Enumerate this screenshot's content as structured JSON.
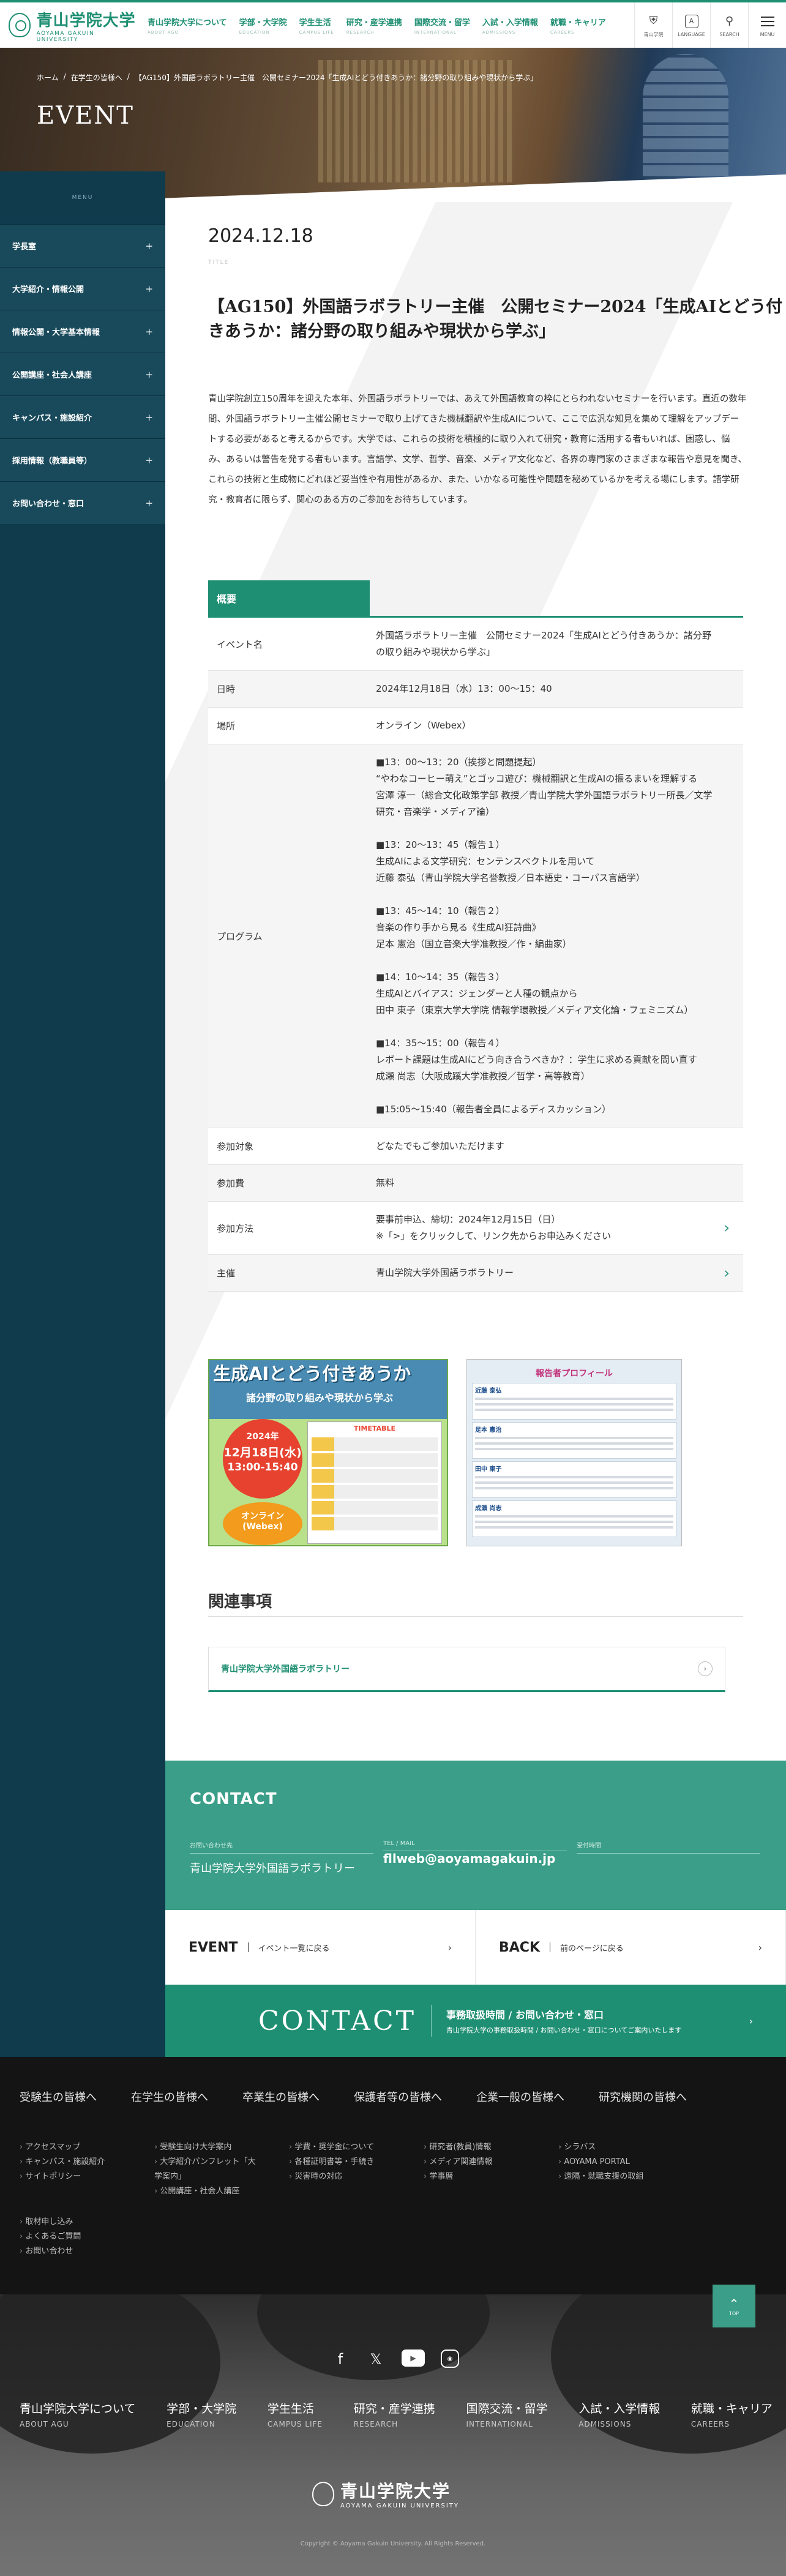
{
  "header": {
    "logo_jp": "青山学院大学",
    "logo_en": "AOYAMA GAKUIN UNIVERSITY",
    "nav": [
      {
        "label": "青山学院大学について",
        "sub": "ABOUT AGU"
      },
      {
        "label": "学部・大学院",
        "sub": "EDUCATION"
      },
      {
        "label": "学生生活",
        "sub": "CAMPUS LIFE"
      },
      {
        "label": "研究・産学連携",
        "sub": "RESEARCH"
      },
      {
        "label": "国際交流・留学",
        "sub": "INTERNATIONAL"
      },
      {
        "label": "入試・入学情報",
        "sub": "ADMISSIONS"
      },
      {
        "label": "就職・キャリア",
        "sub": "CAREERS"
      }
    ],
    "icons": [
      {
        "label": "青山学院",
        "icon": "school-emblem-icon"
      },
      {
        "label": "LANGUAGE",
        "icon": "language-icon"
      },
      {
        "label": "SEARCH",
        "icon": "search-icon"
      },
      {
        "label": "MENU",
        "icon": "menu-icon"
      }
    ]
  },
  "hero": {
    "breadcrumb": [
      "ホーム",
      "在学生の皆様へ",
      "【AG150】外国語ラボラトリー主催　公開セミナー2024「生成AIとどう付きあうか：諸分野の取り組みや現状から学ぶ」"
    ],
    "title": "EVENT"
  },
  "sidebar": {
    "heading": "MENU",
    "items": [
      "学長室",
      "大学紹介・情報公開",
      "情報公開・大学基本情報",
      "公開講座・社会人講座",
      "キャンパス・施設紹介",
      "採用情報（教職員等）",
      "お問い合わせ・窓口"
    ]
  },
  "article": {
    "date": "2024.12.18",
    "title_label": "TITLE",
    "title": "【AG150】外国語ラボラトリー主催　公開セミナー2024「生成AIとどう付きあうか：諸分野の取り組みや現状から学ぶ」",
    "lead": "青山学院創立150周年を迎えた本年、外国語ラボラトリーでは、あえて外国語教育の枠にとらわれないセミナーを行います。直近の数年間、外国語ラボラトリー主催公開セミナーで取り上げてきた機械翻訳や生成AIについて、ここで広汎な知見を集めて理解をアップデートする必要があると考えるからです。大学では、これらの技術を積極的に取り入れて研究・教育に活用する者もいれば、困惑し、悩み、あるいは警告を発する者もいます。言語学、文学、哲学、音楽、メディア文化など、各界の専門家のさまざまな報告や意見を聞き、これらの技術と生成物にどれほど妥当性や有用性があるか、また、いかなる可能性や問題を秘めているかを考える場にします。語学研究・教育者に限らず、関心のある方のご参加をお待ちしています。",
    "overview_tab": "概要",
    "rows": [
      {
        "th": "イベント名",
        "td": "外国語ラボラトリー主催　公開セミナー2024「生成AIとどう付きあうか：諸分野の取り組みや現状から学ぶ」"
      },
      {
        "th": "日時",
        "td": "2024年12月18日（水）13：00～15：40"
      },
      {
        "th": "場所",
        "td": "オンライン（Webex）"
      }
    ],
    "program_label": "プログラム",
    "program": [
      "■13：00～13：20（挨拶と問題提起）",
      "“やわなコーヒー萌え”とゴッコ遊び：機械翻訳と生成AIの振るまいを理解する",
      "宮澤 淳一（総合文化政策学部 教授／青山学院大学外国語ラボラトリー所長／文学研究・音楽学・メディア論）",
      "",
      "■13：20～13：45（報告１）",
      "生成AIによる文学研究：センテンスベクトルを用いて",
      "近藤 泰弘（青山学院大学名誉教授／日本語史・コーパス言語学）",
      "",
      "■13：45～14：10（報告２）",
      "音楽の作り手から見る《生成AI狂詩曲》",
      "足本 憲治（国立音楽大学准教授／作・編曲家）",
      "",
      "■14：10～14：35（報告３）",
      "生成AIとバイアス：ジェンダーと人種の観点から",
      "田中 東子（東京大学大学院 情報学環教授／メディア文化論・フェミニズム）",
      "",
      "■14：35～15：00（報告４）",
      "レポート課題は生成AIにどう向き合うべきか？：学生に求める貢献を問い直す",
      "成瀬 尚志（大阪成蹊大学准教授／哲学・高等教育）",
      "",
      "■15:05～15:40（報告者全員によるディスカッション）"
    ],
    "rows2": [
      {
        "th": "参加対象",
        "td": "どなたでもご参加いただけます"
      },
      {
        "th": "参加費",
        "td": "無料"
      }
    ],
    "apply_label": "参加方法",
    "apply_line1": "要事前申込、締切：2024年12月15日（日）",
    "apply_line2": "※「>」をクリックして、リンク先からお申込みください",
    "host_label": "主催",
    "host": "青山学院大学外国語ラボラトリー",
    "flyer1": {
      "title": "生成AIとどう付きあうか",
      "subtitle": "諸分野の取り組みや現状から学ぶ",
      "year": "2024年",
      "date": "12月18日(水)",
      "time": "13:00-15:40",
      "online": "オンライン(Webex)",
      "timetable": "TIMETABLE"
    },
    "flyer2": {
      "header": "報告者プロフィール",
      "speakers": [
        "近藤 泰弘",
        "足本 憲治",
        "田中 東子",
        "成瀬 尚志"
      ]
    },
    "related_heading": "関連事項",
    "related_link": "青山学院大学外国語ラボラトリー"
  },
  "contact": {
    "heading": "CONTACT",
    "cols": [
      {
        "label": "お問い合わせ先",
        "value": "青山学院大学外国語ラボラトリー"
      },
      {
        "label": "TEL / MAIL",
        "value": "fllweb@aoyamagakuin.jp"
      },
      {
        "label": "受付時間",
        "value": ""
      }
    ]
  },
  "eventback": [
    {
      "big": "EVENT",
      "small": "イベント一覧に戻る"
    },
    {
      "big": "BACK",
      "small": "前のページに戻る"
    }
  ],
  "contact2": {
    "big": "CONTACT",
    "t1": "事務取扱時間 / お問い合わせ・窓口",
    "t2": "青山学院大学の事務取扱時間 / お問い合わせ・窓口についてご案内いたします"
  },
  "footer": {
    "tabs": [
      "受験生の皆様へ",
      "在学生の皆様へ",
      "卒業生の皆様へ",
      "保護者等の皆様へ",
      "企業一般の皆様へ",
      "研究機関の皆様へ"
    ],
    "cols": [
      [
        "アクセスマップ",
        "キャンパス・施設紹介",
        "サイトポリシー"
      ],
      [
        "受験生向け大学案内",
        "大学紹介パンフレット「大学案内」",
        "公開講座・社会人講座"
      ],
      [
        "学費・奨学金について",
        "各種証明書等・手続き",
        "災害時の対応"
      ],
      [
        "研究者(教員)情報",
        "メディア関連情報",
        "学事暦"
      ],
      [
        "シラバス",
        "AOYAMA PORTAL",
        "遠隔・就職支援の取組"
      ]
    ],
    "extra": [
      "取材申し込み",
      "よくあるご質問",
      "お問い合わせ"
    ],
    "pagetop": "TOP"
  },
  "photo": {
    "social": [
      "facebook-icon",
      "x-icon",
      "youtube-icon",
      "instagram-icon"
    ],
    "nav": [
      {
        "label": "青山学院大学について",
        "sub": "ABOUT AGU"
      },
      {
        "label": "学部・大学院",
        "sub": "EDUCATION"
      },
      {
        "label": "学生生活",
        "sub": "CAMPUS LIFE"
      },
      {
        "label": "研究・産学連携",
        "sub": "RESEARCH"
      },
      {
        "label": "国際交流・留学",
        "sub": "INTERNATIONAL"
      },
      {
        "label": "入試・入学情報",
        "sub": "ADMISSIONS"
      },
      {
        "label": "就職・キャリア",
        "sub": "CAREERS"
      }
    ],
    "logo_jp": "青山学院大学",
    "logo_en": "AOYAMA GAKUIN UNIVERSITY",
    "copyright": "Copyright © Aoyama Gakuin University. All Rights Reserved."
  }
}
